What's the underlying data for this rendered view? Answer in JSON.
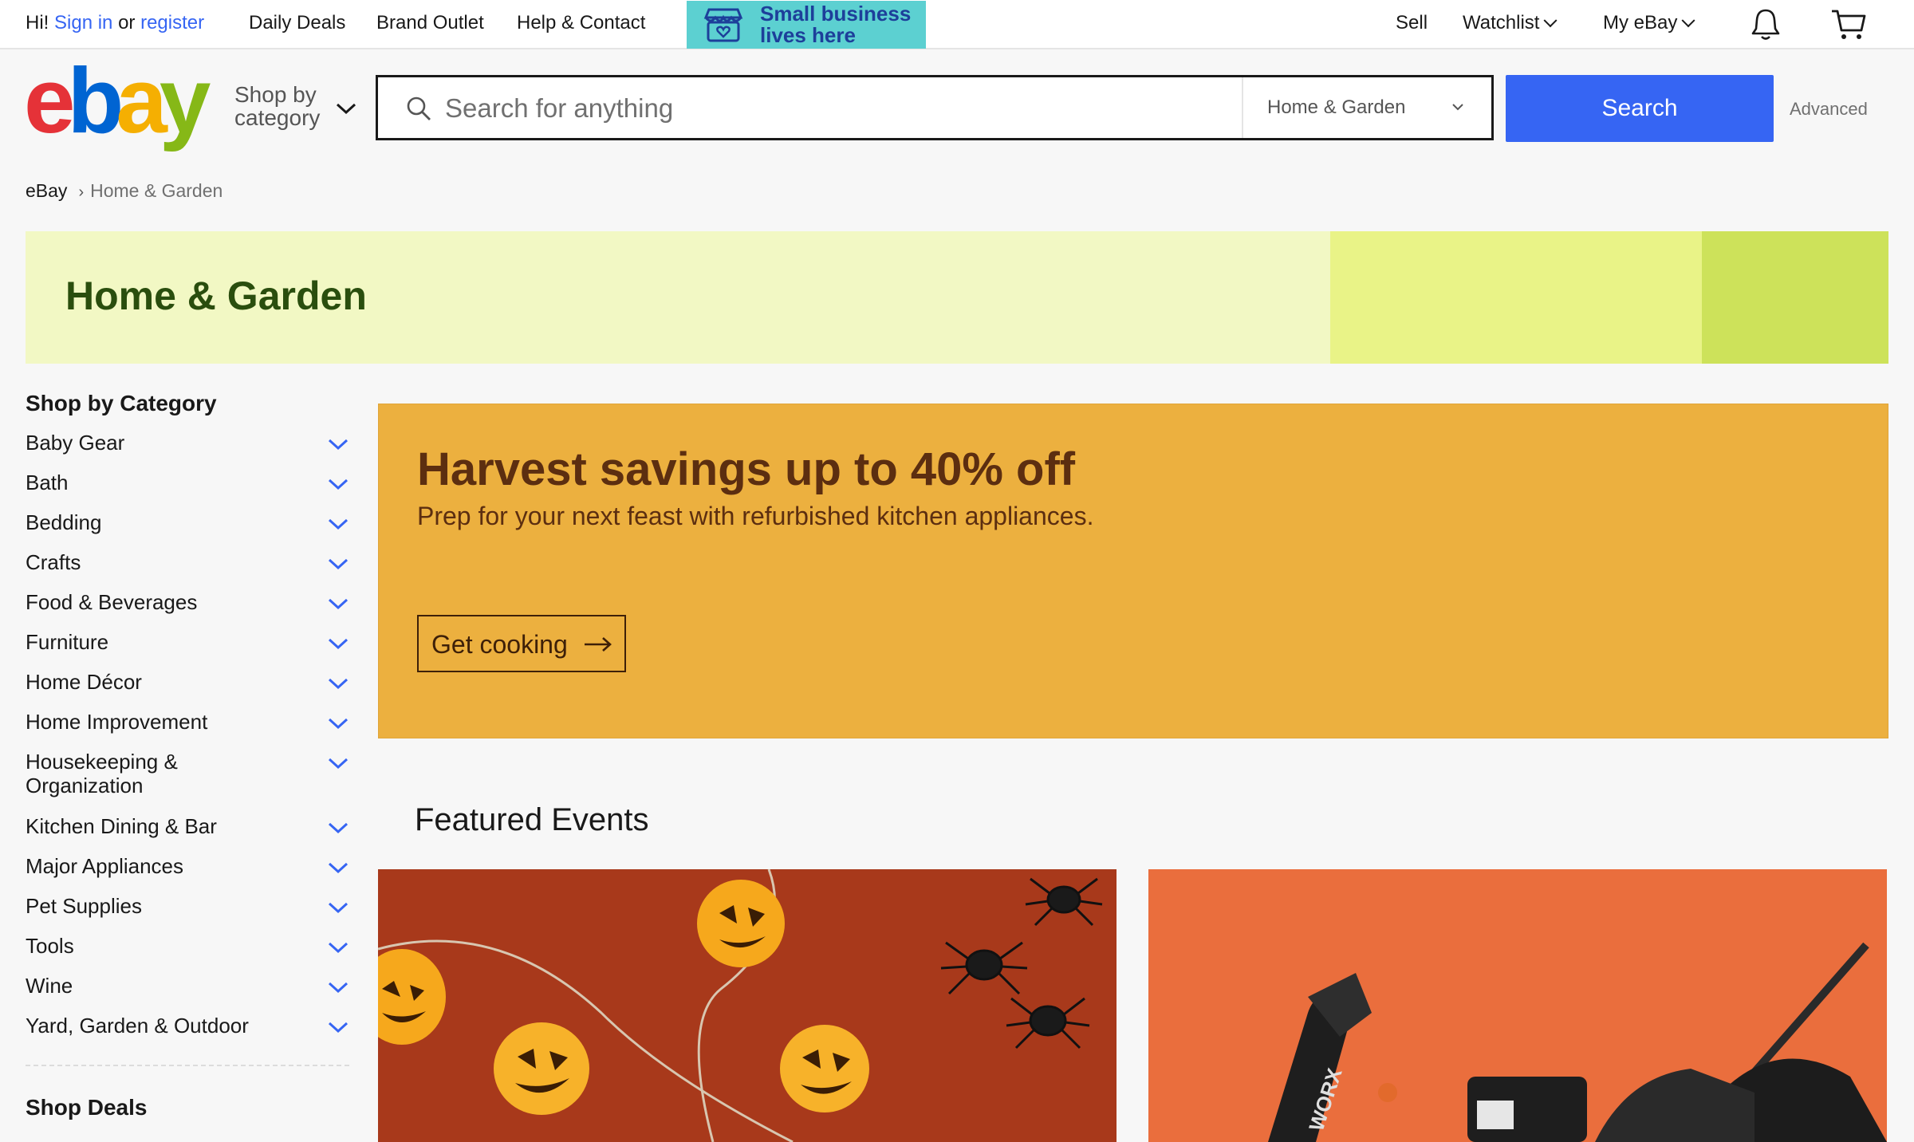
{
  "topbar": {
    "greeting_prefix": "Hi!",
    "sign_in": "Sign in",
    "or": "or",
    "register": "register",
    "links": [
      "Daily Deals",
      "Brand Outlet",
      "Help & Contact"
    ],
    "promo_line1": "Small business",
    "promo_line2": "lives here",
    "sell": "Sell",
    "watchlist": "Watchlist",
    "my_ebay": "My eBay",
    "icons": [
      "bell-icon",
      "cart-icon",
      "chevron-down-icon"
    ]
  },
  "header": {
    "logo_letters": [
      "e",
      "b",
      "a",
      "y"
    ],
    "logo_colors": [
      "#e53238",
      "#0064d2",
      "#f5af02",
      "#86b817"
    ],
    "shop_by_line1": "Shop by",
    "shop_by_line2": "category",
    "search_placeholder": "Search for anything",
    "category_select": "Home & Garden",
    "search_button": "Search",
    "advanced": "Advanced",
    "accent": "#3665f3"
  },
  "breadcrumb": {
    "root": "eBay",
    "current": "Home & Garden"
  },
  "banner": {
    "title": "Home & Garden",
    "colors": [
      "#f2f8c4",
      "#e9f387",
      "#cde25a"
    ]
  },
  "sidebar": {
    "heading": "Shop by Category",
    "items": [
      "Baby Gear",
      "Bath",
      "Bedding",
      "Crafts",
      "Food & Beverages",
      "Furniture",
      "Home Décor",
      "Home Improvement",
      "Housekeeping & Organization",
      "Kitchen Dining & Bar",
      "Major Appliances",
      "Pet Supplies",
      "Tools",
      "Wine",
      "Yard, Garden & Outdoor"
    ],
    "deals_heading": "Shop Deals"
  },
  "hero": {
    "title": "Harvest savings up to 40% off",
    "subtitle": "Prep for your next feast with refurbished kitchen appliances.",
    "cta": "Get cooking",
    "background": "#ecb03f"
  },
  "featured": {
    "title": "Featured Events",
    "card_colors": [
      "#a8391b",
      "#ea6e3d"
    ],
    "card2_brand": "WORX"
  }
}
